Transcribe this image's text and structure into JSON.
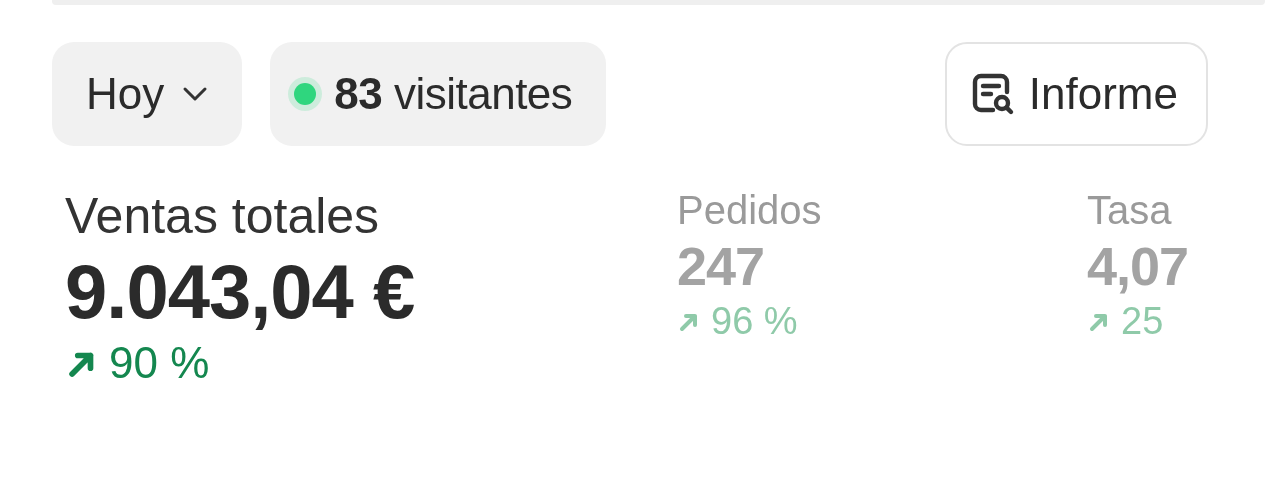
{
  "toolbar": {
    "period": {
      "label": "Hoy"
    },
    "live": {
      "text": "**83** visitantes",
      "on": true
    },
    "report_button": {
      "label": "Informe"
    }
  },
  "metrics": [
    {
      "kind": "primary",
      "label": "Ventas totales",
      "value": "9.043,04 €",
      "trend": "90 %"
    },
    {
      "kind": "secondary",
      "label": "Pedidos",
      "value": "247",
      "trend": "96 %"
    },
    {
      "kind": "secondary",
      "label": "Tasa",
      "value": "4,07",
      "trend": "25"
    }
  ]
}
